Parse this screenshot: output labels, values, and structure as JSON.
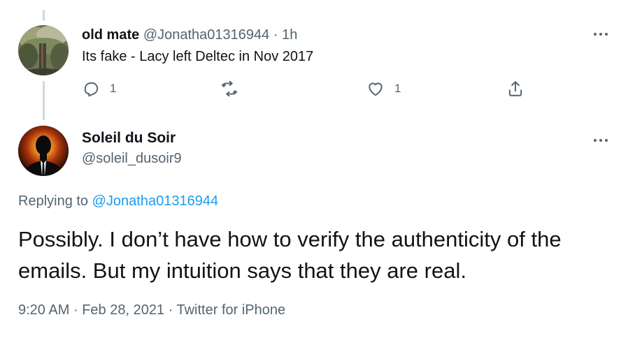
{
  "reply": {
    "name": "old mate",
    "handle": "@Jonatha01316944",
    "separator": "·",
    "time": "1h",
    "text": "Its fake - Lacy left Deltec in Nov 2017",
    "actions": {
      "reply_icon": "reply-icon",
      "reply_count": "1",
      "retweet_icon": "retweet-icon",
      "retweet_count": "",
      "like_icon": "heart-icon",
      "like_count": "1",
      "share_icon": "share-icon"
    },
    "more_icon": "more-icon"
  },
  "main": {
    "name": "Soleil du Soir",
    "handle": "@soleil_dusoir9",
    "replying_prefix": "Replying to",
    "replying_to": "@Jonatha01316944",
    "text": "Possibly. I don’t have how to verify the authenticity of the emails. But my intuition says that they are real.",
    "time": "9:20 AM",
    "sep1": "·",
    "date": "Feb 28, 2021",
    "sep2": "·",
    "source": "Twitter for iPhone",
    "more_icon": "more-icon"
  },
  "colors": {
    "text": "#0f1419",
    "secondary": "#536471",
    "link": "#1d9bf0",
    "thread_line": "#cfd9de"
  }
}
